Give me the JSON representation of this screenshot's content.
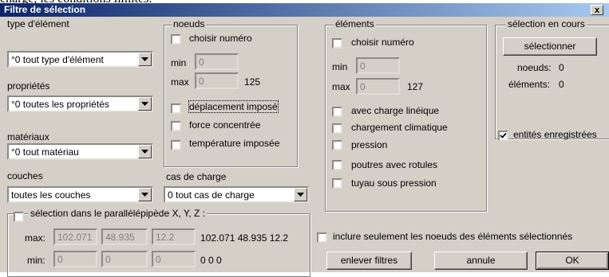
{
  "peek_text": "charge, les conditions limites.",
  "window": {
    "title": "Filtre de sélection",
    "close_label": "x"
  },
  "left": {
    "type_label": "type d'élément",
    "type_value": "°0 tout type d'élément",
    "prop_label": "propriétés",
    "prop_value": "°0 toutes les propriétés",
    "mat_label": "matériaux",
    "mat_value": "°0 tout matériau",
    "couches_label": "couches",
    "couches_value": "toutes les couches"
  },
  "noeuds": {
    "title": "noeuds",
    "choisir": "choisir numéro",
    "min_label": "min",
    "min_value": "0",
    "max_label": "max",
    "max_value": "0",
    "count": "125",
    "deplacement": "déplacement imposé",
    "force": "force concentrée",
    "temperature": "température imposée"
  },
  "cas": {
    "label": "cas de charge",
    "value": "0 tout cas de charge"
  },
  "elements": {
    "title": "éléments",
    "choisir": "choisir numéro",
    "min_label": "min",
    "min_value": "0",
    "max_label": "max",
    "max_value": "0",
    "count": "127",
    "charge_lineique": "avec charge linéique",
    "climatique": "chargement climatique",
    "pression": "pression",
    "poutres": "poutres avec rotules",
    "tuyau": "tuyau sous pression"
  },
  "selection": {
    "title": "sélection en cours",
    "button": "sélectionner",
    "noeuds_label": "noeuds:",
    "noeuds_value": "0",
    "elements_label": "éléments:",
    "elements_value": "0"
  },
  "entites": {
    "label": "entités enregistrées",
    "checked": true
  },
  "parallel": {
    "title": "sélection dans le parallélépipède X, Y, Z :",
    "max_label": "max:",
    "max_x": "102.071",
    "max_y": "48.935",
    "max_z": "12.2",
    "max_text": "102.071 48.935 12.2",
    "min_label": "min:",
    "min_x": "0",
    "min_y": "0",
    "min_z": "0",
    "min_text": "0 0 0"
  },
  "inclure": "inclure seulement les noeuds des éléments sélectionnés",
  "buttons": {
    "enlever": "enlever filtres",
    "annule": "annule",
    "ok": "OK"
  },
  "colors": {
    "titlebar_start": "#0a246a",
    "titlebar_end": "#a6caf0",
    "dialog_bg": "#d4d0c8"
  }
}
